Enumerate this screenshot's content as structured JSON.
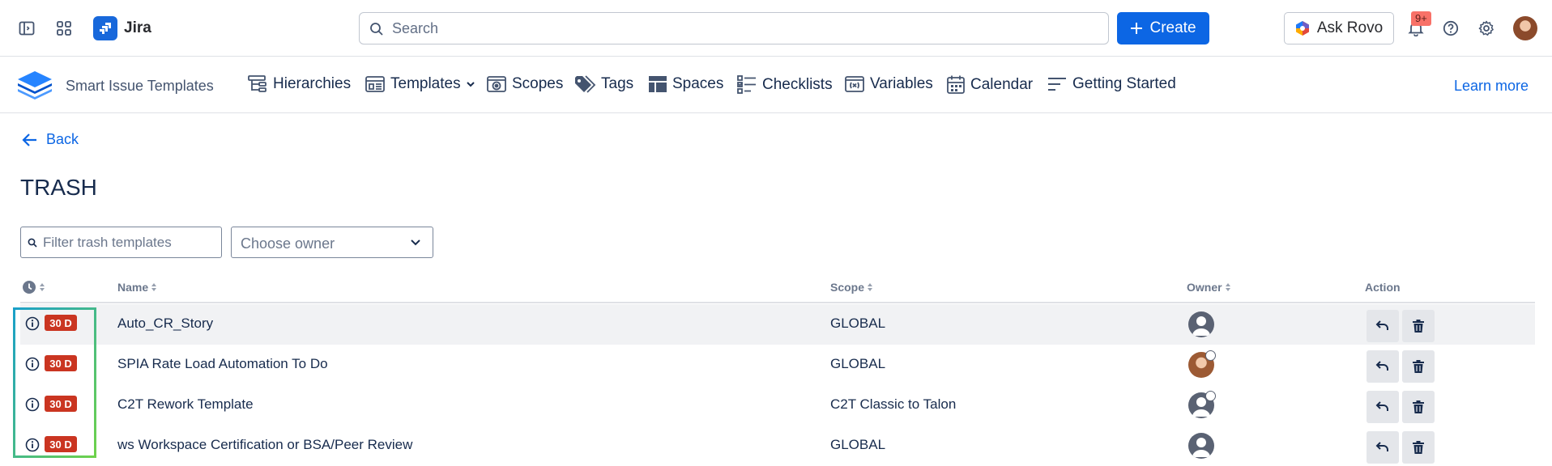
{
  "topbar": {
    "app_name": "Jira",
    "search_placeholder": "Search",
    "create_label": "Create",
    "rovo_label": "Ask Rovo",
    "notification_count": "9+"
  },
  "appnav": {
    "app_title": "Smart Issue Templates",
    "items": [
      {
        "label": "Hierarchies",
        "icon": "hierarchy-icon"
      },
      {
        "label": "Templates",
        "icon": "template-icon"
      },
      {
        "label": "Scopes",
        "icon": "scope-icon"
      },
      {
        "label": "Tags",
        "icon": "tag-icon"
      },
      {
        "label": "Spaces",
        "icon": "space-icon"
      },
      {
        "label": "Checklists",
        "icon": "checklist-icon"
      },
      {
        "label": "Variables",
        "icon": "variable-icon"
      },
      {
        "label": "Calendar",
        "icon": "calendar-icon"
      },
      {
        "label": "Getting Started",
        "icon": "lines-icon"
      }
    ],
    "learn_more": "Learn more"
  },
  "page": {
    "back_label": "Back",
    "title": "TRASH",
    "filter_placeholder": "Filter trash templates",
    "owner_placeholder": "Choose owner"
  },
  "table": {
    "headers": {
      "name": "Name",
      "scope": "Scope",
      "owner": "Owner",
      "action": "Action"
    },
    "rows": [
      {
        "days": "30 D",
        "name": "Auto_CR_Story",
        "scope": "GLOBAL",
        "owner_avatar": "generic"
      },
      {
        "days": "30 D",
        "name": "SPIA Rate Load Automation To Do",
        "scope": "GLOBAL",
        "owner_avatar": "photo"
      },
      {
        "days": "30 D",
        "name": "C2T Rework Template",
        "scope": "C2T Classic to Talon",
        "owner_avatar": "generic-badge"
      },
      {
        "days": "30 D",
        "name": "ws Workspace Certification or BSA/Peer Review",
        "scope": "GLOBAL",
        "owner_avatar": "generic"
      }
    ]
  },
  "colors": {
    "primary": "#0c66e4",
    "badge_red": "#ca3521",
    "highlight_row": "#f1f2f4"
  }
}
